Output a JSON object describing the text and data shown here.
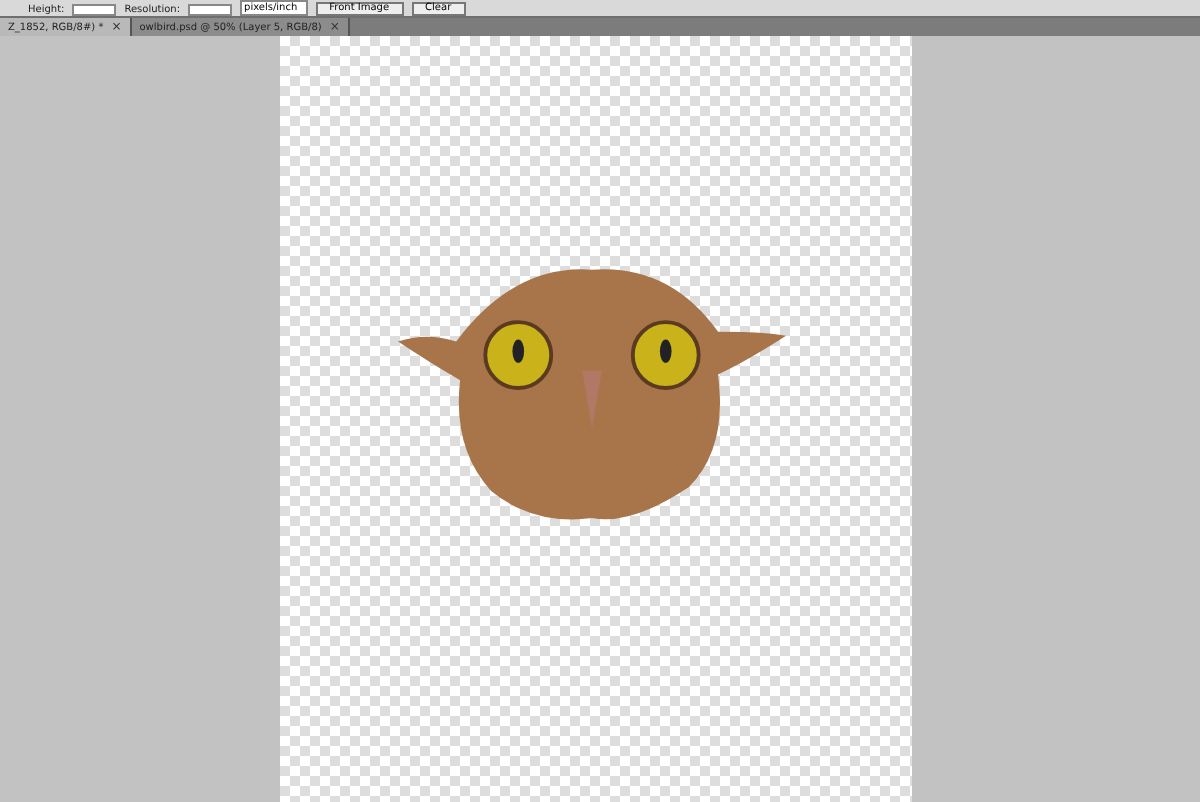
{
  "options_bar": {
    "height_label": "Height:",
    "resolution_label": "Resolution:",
    "unit": "pixels/inch",
    "buttons": [
      "Front Image",
      "Clear"
    ]
  },
  "tabs": [
    {
      "label": "Z_1852, RGB/8#) *",
      "close": "×",
      "selected": true
    },
    {
      "label": "owlbird.psd @ 50% (Layer 5, RGB/8)",
      "close": "×",
      "selected": false
    }
  ]
}
